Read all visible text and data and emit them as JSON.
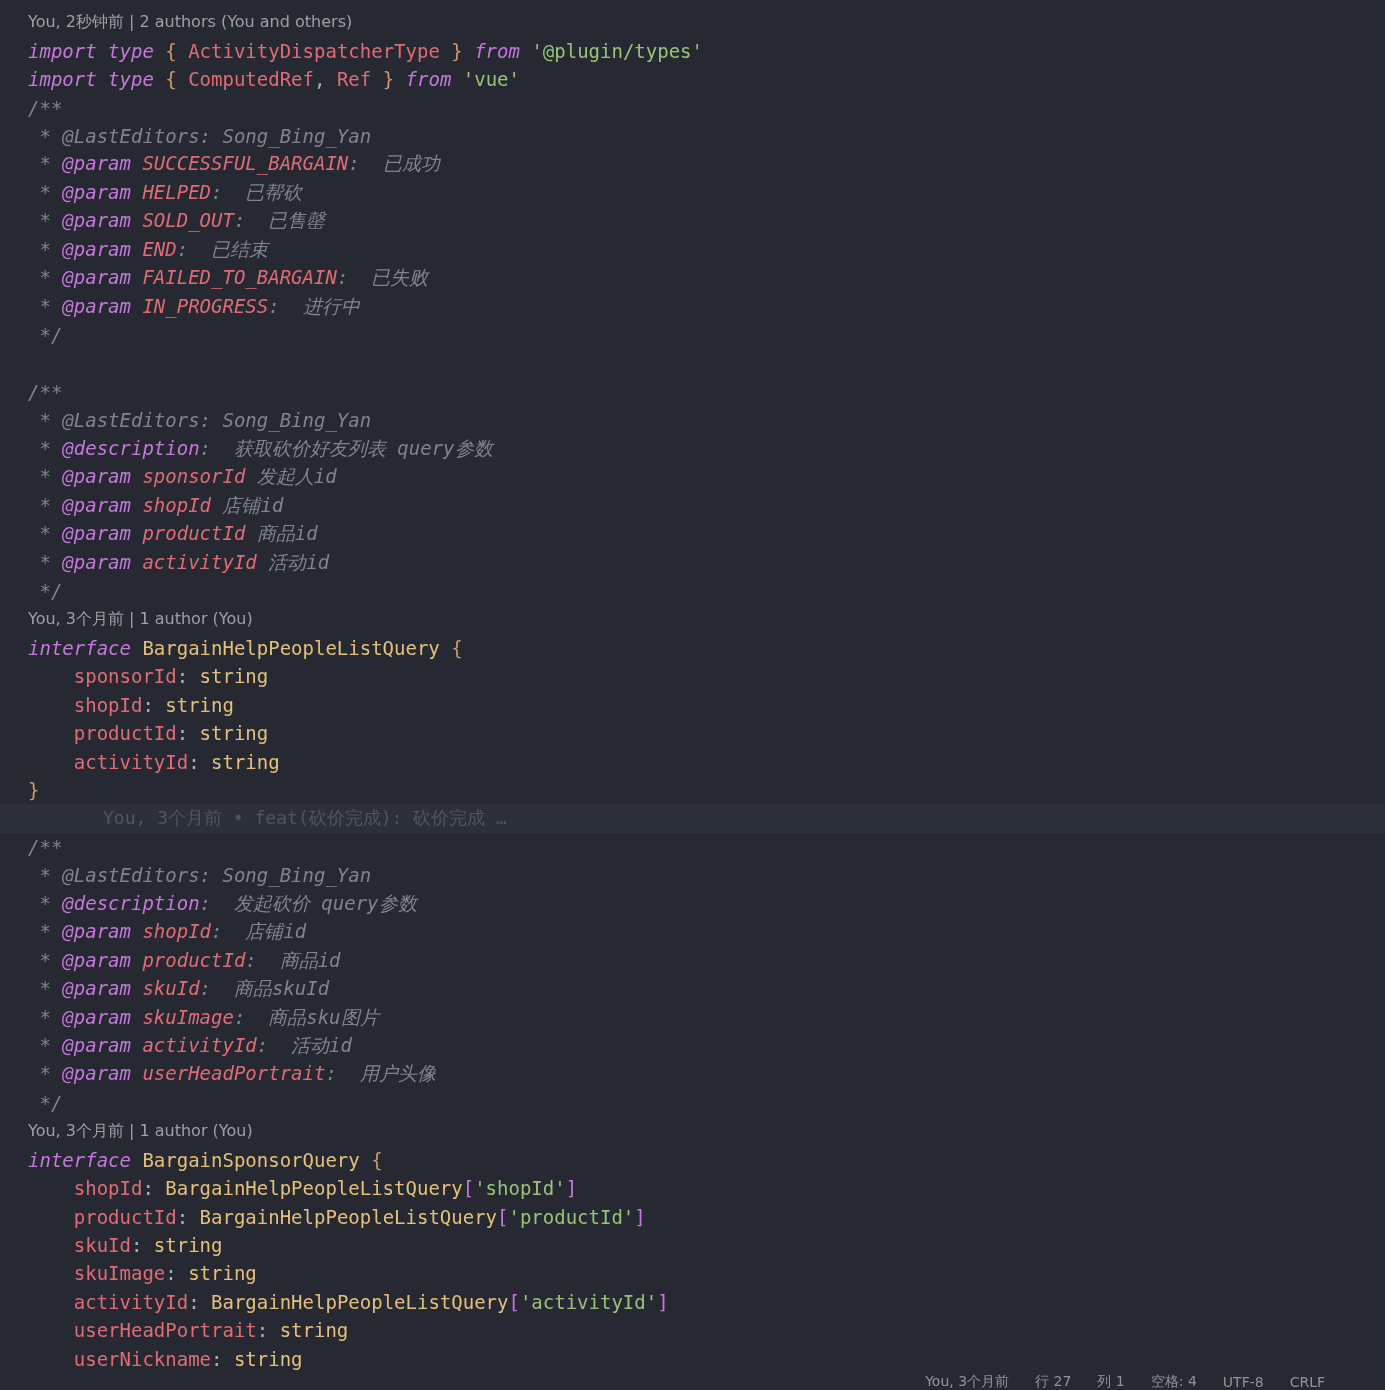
{
  "editor": {
    "lines": [
      {
        "kind": "lens",
        "text": "You, 2秒钟前 | 2 authors (You and others)"
      },
      {
        "kind": "code",
        "tokens": [
          {
            "t": "import type ",
            "kind": "kw"
          },
          {
            "t": "{ ",
            "kind": "brace"
          },
          {
            "t": "ActivityDispatcherType ",
            "kind": "id"
          },
          {
            "t": "} ",
            "kind": "brace"
          },
          {
            "t": "from ",
            "kind": "kw"
          },
          {
            "t": "'@plugin/types'",
            "kind": "str"
          }
        ]
      },
      {
        "kind": "code",
        "tokens": [
          {
            "t": "import type ",
            "kind": "kw"
          },
          {
            "t": "{ ",
            "kind": "brace"
          },
          {
            "t": "ComputedRef",
            "kind": "id"
          },
          {
            "t": ", ",
            "kind": "punc"
          },
          {
            "t": "Ref ",
            "kind": "id"
          },
          {
            "t": "} ",
            "kind": "brace"
          },
          {
            "t": "from ",
            "kind": "kw"
          },
          {
            "t": "'vue'",
            "kind": "str"
          }
        ]
      },
      {
        "kind": "code",
        "tokens": [
          {
            "t": "/**",
            "kind": "cmt"
          }
        ]
      },
      {
        "kind": "code",
        "tokens": [
          {
            "t": " * @LastEditors: Song_Bing_Yan",
            "kind": "cmt"
          }
        ]
      },
      {
        "kind": "code",
        "tokens": [
          {
            "t": " * ",
            "kind": "cmt"
          },
          {
            "t": "@param ",
            "kind": "tag"
          },
          {
            "t": "SUCCESSFUL_BARGAIN",
            "kind": "pname"
          },
          {
            "t": ":  已成功",
            "kind": "cmt"
          }
        ]
      },
      {
        "kind": "code",
        "tokens": [
          {
            "t": " * ",
            "kind": "cmt"
          },
          {
            "t": "@param ",
            "kind": "tag"
          },
          {
            "t": "HELPED",
            "kind": "pname"
          },
          {
            "t": ":  已帮砍",
            "kind": "cmt"
          }
        ]
      },
      {
        "kind": "code",
        "tokens": [
          {
            "t": " * ",
            "kind": "cmt"
          },
          {
            "t": "@param ",
            "kind": "tag"
          },
          {
            "t": "SOLD_OUT",
            "kind": "pname"
          },
          {
            "t": ":  已售罄",
            "kind": "cmt"
          }
        ]
      },
      {
        "kind": "code",
        "tokens": [
          {
            "t": " * ",
            "kind": "cmt"
          },
          {
            "t": "@param ",
            "kind": "tag"
          },
          {
            "t": "END",
            "kind": "pname"
          },
          {
            "t": ":  已结束",
            "kind": "cmt"
          }
        ]
      },
      {
        "kind": "code",
        "tokens": [
          {
            "t": " * ",
            "kind": "cmt"
          },
          {
            "t": "@param ",
            "kind": "tag"
          },
          {
            "t": "FAILED_TO_BARGAIN",
            "kind": "pname"
          },
          {
            "t": ":  已失败",
            "kind": "cmt"
          }
        ]
      },
      {
        "kind": "code",
        "tokens": [
          {
            "t": " * ",
            "kind": "cmt"
          },
          {
            "t": "@param ",
            "kind": "tag"
          },
          {
            "t": "IN_PROGRESS",
            "kind": "pname"
          },
          {
            "t": ":  进行中",
            "kind": "cmt"
          }
        ]
      },
      {
        "kind": "code",
        "tokens": [
          {
            "t": " */",
            "kind": "cmt"
          }
        ]
      },
      {
        "kind": "blank"
      },
      {
        "kind": "code",
        "tokens": [
          {
            "t": "/**",
            "kind": "cmt"
          }
        ]
      },
      {
        "kind": "code",
        "tokens": [
          {
            "t": " * @LastEditors: Song_Bing_Yan",
            "kind": "cmt"
          }
        ]
      },
      {
        "kind": "code",
        "tokens": [
          {
            "t": " * ",
            "kind": "cmt"
          },
          {
            "t": "@description",
            "kind": "tag"
          },
          {
            "t": ":  获取砍价好友列表 query参数",
            "kind": "cmt"
          }
        ]
      },
      {
        "kind": "code",
        "tokens": [
          {
            "t": " * ",
            "kind": "cmt"
          },
          {
            "t": "@param ",
            "kind": "tag"
          },
          {
            "t": "sponsorId",
            "kind": "pname"
          },
          {
            "t": " 发起人id",
            "kind": "cmt"
          }
        ]
      },
      {
        "kind": "code",
        "tokens": [
          {
            "t": " * ",
            "kind": "cmt"
          },
          {
            "t": "@param ",
            "kind": "tag"
          },
          {
            "t": "shopId",
            "kind": "pname"
          },
          {
            "t": " 店铺id",
            "kind": "cmt"
          }
        ]
      },
      {
        "kind": "code",
        "tokens": [
          {
            "t": " * ",
            "kind": "cmt"
          },
          {
            "t": "@param ",
            "kind": "tag"
          },
          {
            "t": "productId",
            "kind": "pname"
          },
          {
            "t": " 商品id",
            "kind": "cmt"
          }
        ]
      },
      {
        "kind": "code",
        "tokens": [
          {
            "t": " * ",
            "kind": "cmt"
          },
          {
            "t": "@param ",
            "kind": "tag"
          },
          {
            "t": "activityId",
            "kind": "pname"
          },
          {
            "t": " 活动id",
            "kind": "cmt"
          }
        ]
      },
      {
        "kind": "code",
        "tokens": [
          {
            "t": " */",
            "kind": "cmt"
          }
        ]
      },
      {
        "kind": "lens",
        "text": "You, 3个月前 | 1 author (You)"
      },
      {
        "kind": "code",
        "tokens": [
          {
            "t": "interface ",
            "kind": "kw"
          },
          {
            "t": "BargainHelpPeopleListQuery ",
            "kind": "type"
          },
          {
            "t": "{",
            "kind": "brace"
          }
        ]
      },
      {
        "kind": "code",
        "tokens": [
          {
            "t": "    sponsorId",
            "kind": "id"
          },
          {
            "t": ": ",
            "kind": "punc"
          },
          {
            "t": "string",
            "kind": "type"
          }
        ]
      },
      {
        "kind": "code",
        "tokens": [
          {
            "t": "    shopId",
            "kind": "id"
          },
          {
            "t": ": ",
            "kind": "punc"
          },
          {
            "t": "string",
            "kind": "type"
          }
        ]
      },
      {
        "kind": "code",
        "tokens": [
          {
            "t": "    productId",
            "kind": "id"
          },
          {
            "t": ": ",
            "kind": "punc"
          },
          {
            "t": "string",
            "kind": "type"
          }
        ]
      },
      {
        "kind": "code",
        "tokens": [
          {
            "t": "    activityId",
            "kind": "id"
          },
          {
            "t": ": ",
            "kind": "punc"
          },
          {
            "t": "string",
            "kind": "type"
          }
        ]
      },
      {
        "kind": "code",
        "tokens": [
          {
            "t": "}",
            "kind": "brace"
          }
        ]
      },
      {
        "kind": "blame",
        "text": "You, 3个月前 • feat(砍价完成): 砍价完成 …"
      },
      {
        "kind": "code",
        "tokens": [
          {
            "t": "/**",
            "kind": "cmt"
          }
        ]
      },
      {
        "kind": "code",
        "tokens": [
          {
            "t": " * @LastEditors: Song_Bing_Yan",
            "kind": "cmt"
          }
        ]
      },
      {
        "kind": "code",
        "tokens": [
          {
            "t": " * ",
            "kind": "cmt"
          },
          {
            "t": "@description",
            "kind": "tag"
          },
          {
            "t": ":  发起砍价 query参数",
            "kind": "cmt"
          }
        ]
      },
      {
        "kind": "code",
        "tokens": [
          {
            "t": " * ",
            "kind": "cmt"
          },
          {
            "t": "@param ",
            "kind": "tag"
          },
          {
            "t": "shopId",
            "kind": "pname"
          },
          {
            "t": ":  店铺id",
            "kind": "cmt"
          }
        ]
      },
      {
        "kind": "code",
        "tokens": [
          {
            "t": " * ",
            "kind": "cmt"
          },
          {
            "t": "@param ",
            "kind": "tag"
          },
          {
            "t": "productId",
            "kind": "pname"
          },
          {
            "t": ":  商品id",
            "kind": "cmt"
          }
        ]
      },
      {
        "kind": "code",
        "tokens": [
          {
            "t": " * ",
            "kind": "cmt"
          },
          {
            "t": "@param ",
            "kind": "tag"
          },
          {
            "t": "skuId",
            "kind": "pname"
          },
          {
            "t": ":  商品skuId",
            "kind": "cmt"
          }
        ]
      },
      {
        "kind": "code",
        "tokens": [
          {
            "t": " * ",
            "kind": "cmt"
          },
          {
            "t": "@param ",
            "kind": "tag"
          },
          {
            "t": "skuImage",
            "kind": "pname"
          },
          {
            "t": ":  商品sku图片",
            "kind": "cmt"
          }
        ]
      },
      {
        "kind": "code",
        "tokens": [
          {
            "t": " * ",
            "kind": "cmt"
          },
          {
            "t": "@param ",
            "kind": "tag"
          },
          {
            "t": "activityId",
            "kind": "pname"
          },
          {
            "t": ":  活动id",
            "kind": "cmt"
          }
        ]
      },
      {
        "kind": "code",
        "tokens": [
          {
            "t": " * ",
            "kind": "cmt"
          },
          {
            "t": "@param ",
            "kind": "tag"
          },
          {
            "t": "userHeadPortrait",
            "kind": "pname"
          },
          {
            "t": ":  用户头像",
            "kind": "cmt"
          }
        ]
      },
      {
        "kind": "code",
        "tokens": [
          {
            "t": " */",
            "kind": "cmt"
          }
        ]
      },
      {
        "kind": "lens",
        "text": "You, 3个月前 | 1 author (You)"
      },
      {
        "kind": "code",
        "tokens": [
          {
            "t": "interface ",
            "kind": "kw"
          },
          {
            "t": "BargainSponsorQuery ",
            "kind": "type"
          },
          {
            "t": "{",
            "kind": "brace"
          }
        ]
      },
      {
        "kind": "code",
        "tokens": [
          {
            "t": "    shopId",
            "kind": "id"
          },
          {
            "t": ": ",
            "kind": "punc"
          },
          {
            "t": "BargainHelpPeopleListQuery",
            "kind": "type"
          },
          {
            "t": "[",
            "kind": "bracket"
          },
          {
            "t": "'shopId'",
            "kind": "str"
          },
          {
            "t": "]",
            "kind": "bracket"
          }
        ]
      },
      {
        "kind": "code",
        "tokens": [
          {
            "t": "    productId",
            "kind": "id"
          },
          {
            "t": ": ",
            "kind": "punc"
          },
          {
            "t": "BargainHelpPeopleListQuery",
            "kind": "type"
          },
          {
            "t": "[",
            "kind": "bracket"
          },
          {
            "t": "'productId'",
            "kind": "str"
          },
          {
            "t": "]",
            "kind": "bracket"
          }
        ]
      },
      {
        "kind": "code",
        "tokens": [
          {
            "t": "    skuId",
            "kind": "id"
          },
          {
            "t": ": ",
            "kind": "punc"
          },
          {
            "t": "string",
            "kind": "type"
          }
        ]
      },
      {
        "kind": "code",
        "tokens": [
          {
            "t": "    skuImage",
            "kind": "id"
          },
          {
            "t": ": ",
            "kind": "punc"
          },
          {
            "t": "string",
            "kind": "type"
          }
        ]
      },
      {
        "kind": "code",
        "tokens": [
          {
            "t": "    activityId",
            "kind": "id"
          },
          {
            "t": ": ",
            "kind": "punc"
          },
          {
            "t": "BargainHelpPeopleListQuery",
            "kind": "type"
          },
          {
            "t": "[",
            "kind": "bracket"
          },
          {
            "t": "'activityId'",
            "kind": "str"
          },
          {
            "t": "]",
            "kind": "bracket"
          }
        ]
      },
      {
        "kind": "code",
        "tokens": [
          {
            "t": "    userHeadPortrait",
            "kind": "id"
          },
          {
            "t": ": ",
            "kind": "punc"
          },
          {
            "t": "string",
            "kind": "type"
          }
        ]
      },
      {
        "kind": "code",
        "tokens": [
          {
            "t": "    userNickname",
            "kind": "id"
          },
          {
            "t": ": ",
            "kind": "punc"
          },
          {
            "t": "string",
            "kind": "type"
          }
        ]
      }
    ]
  },
  "status_bar": {
    "items": [
      "You, 3个月前",
      "行 27",
      "列 1",
      "空格: 4",
      "UTF-8",
      "CRLF"
    ]
  }
}
